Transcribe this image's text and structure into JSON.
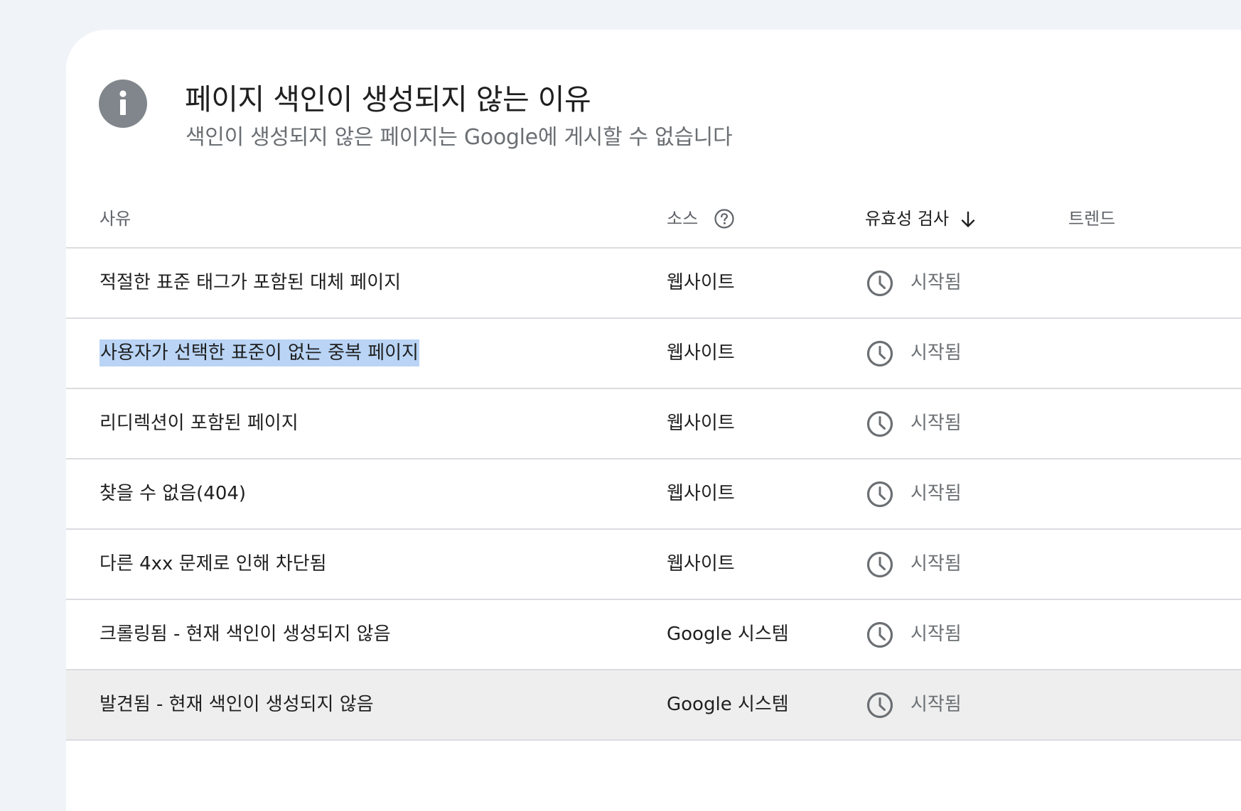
{
  "panel": {
    "title": "페이지 색인이 생성되지 않는 이유",
    "subtitle": "색인이 생성되지 않은 페이지는 Google에 게시할 수 없습니다",
    "icon": "info-icon"
  },
  "table": {
    "headers": {
      "reason": "사유",
      "source": "소스",
      "validation": "유효성 검사",
      "trend": "트렌드"
    },
    "sort": {
      "column": "validation",
      "direction": "descending"
    },
    "rows": [
      {
        "reason": "적절한 표준 태그가 포함된 대체 페이지",
        "source": "웹사이트",
        "status": "시작됨"
      },
      {
        "reason": "사용자가 선택한 표준이 없는 중복 페이지",
        "source": "웹사이트",
        "status": "시작됨"
      },
      {
        "reason": "리디렉션이 포함된 페이지",
        "source": "웹사이트",
        "status": "시작됨"
      },
      {
        "reason": "찾을 수 없음(404)",
        "source": "웹사이트",
        "status": "시작됨"
      },
      {
        "reason": "다른 4xx 문제로 인해 차단됨",
        "source": "웹사이트",
        "status": "시작됨"
      },
      {
        "reason": "크롤링됨 - 현재 색인이 생성되지 않음",
        "source": "Google 시스템",
        "status": "시작됨"
      },
      {
        "reason": "발견됨 - 현재 색인이 생성되지 않음",
        "source": "Google 시스템",
        "status": "시작됨"
      }
    ]
  },
  "colors": {
    "background": "#f0f4f9",
    "card": "#ffffff",
    "icon_gray": "#80868b",
    "selection": "#b9d4f5",
    "row_hover": "#eeeeee",
    "divider": "#dadce0"
  }
}
